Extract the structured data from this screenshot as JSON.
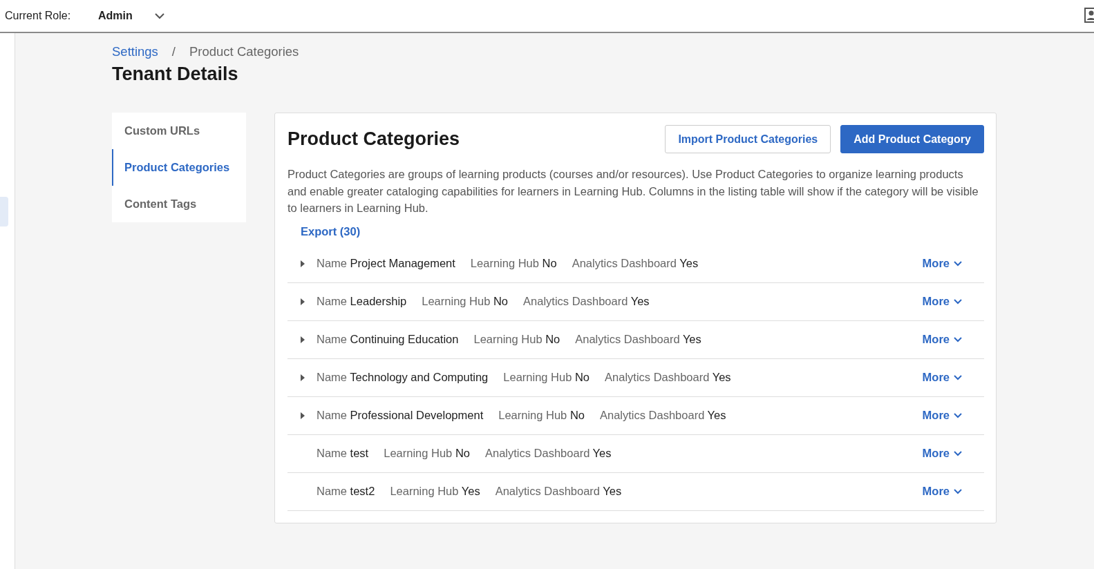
{
  "header": {
    "role_label": "Current Role:",
    "role_value": "Admin"
  },
  "breadcrumb": [
    {
      "label": "Settings",
      "kind": "link"
    },
    {
      "label": "/",
      "kind": "separator"
    },
    {
      "label": "Product Categories",
      "kind": "current"
    }
  ],
  "page_title": "Tenant Details",
  "side_nav": [
    {
      "label": "Custom URLs",
      "selected": false
    },
    {
      "label": "Product Categories",
      "selected": true
    },
    {
      "label": "Content Tags",
      "selected": false
    }
  ],
  "panel": {
    "title": "Product Categories",
    "buttons": [
      {
        "label": "Import Product Categories",
        "kind": "secondary"
      },
      {
        "label": "Add Product Category",
        "kind": "primary"
      }
    ],
    "description": "Product Categories are groups of learning products (courses and/or resources). Use Product Categories to organize learning products and enable greater cataloging capabilities for learners in Learning Hub. Columns in the listing table will show if the category will be visible to learners in Learning Hub.",
    "export_link": "Export (30)",
    "rows": [
      {
        "expandable": true,
        "fields": [
          {
            "label": "Name",
            "value": "Project Management"
          },
          {
            "label": "Learning Hub",
            "value": "No"
          },
          {
            "label": "Analytics Dashboard",
            "value": "Yes"
          }
        ],
        "more": "More"
      },
      {
        "expandable": true,
        "fields": [
          {
            "label": "Name",
            "value": "Leadership"
          },
          {
            "label": "Learning Hub",
            "value": "No"
          },
          {
            "label": "Analytics Dashboard",
            "value": "Yes"
          }
        ],
        "more": "More"
      },
      {
        "expandable": true,
        "fields": [
          {
            "label": "Name",
            "value": "Continuing Education"
          },
          {
            "label": "Learning Hub",
            "value": "No"
          },
          {
            "label": "Analytics Dashboard",
            "value": "Yes"
          }
        ],
        "more": "More"
      },
      {
        "expandable": true,
        "fields": [
          {
            "label": "Name",
            "value": "Technology and Computing"
          },
          {
            "label": "Learning Hub",
            "value": "No"
          },
          {
            "label": "Analytics Dashboard",
            "value": "Yes"
          }
        ],
        "more": "More"
      },
      {
        "expandable": true,
        "fields": [
          {
            "label": "Name",
            "value": "Professional Development"
          },
          {
            "label": "Learning Hub",
            "value": "No"
          },
          {
            "label": "Analytics Dashboard",
            "value": "Yes"
          }
        ],
        "more": "More"
      },
      {
        "expandable": false,
        "fields": [
          {
            "label": "Name",
            "value": "test"
          },
          {
            "label": "Learning Hub",
            "value": "No"
          },
          {
            "label": "Analytics Dashboard",
            "value": "Yes"
          }
        ],
        "more": "More"
      },
      {
        "expandable": false,
        "fields": [
          {
            "label": "Name",
            "value": "test2"
          },
          {
            "label": "Learning Hub",
            "value": "Yes"
          },
          {
            "label": "Analytics Dashboard",
            "value": "Yes"
          }
        ],
        "more": "More"
      }
    ]
  }
}
